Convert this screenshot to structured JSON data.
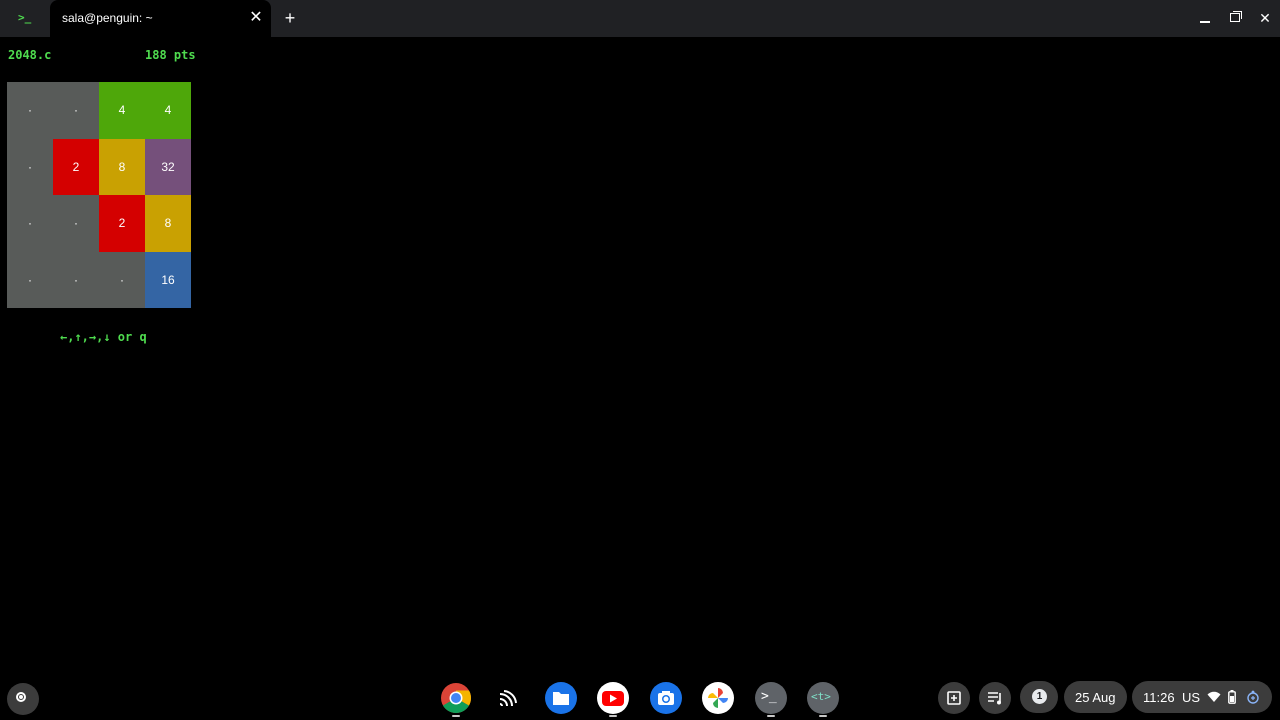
{
  "window": {
    "app_icon": ">_",
    "tab_title": "sala@penguin: ~",
    "tab_close": "✕",
    "new_tab": "+",
    "close": "✕"
  },
  "game": {
    "name": "2048.c",
    "score": "188 pts",
    "controls": "←,↑,→,↓ or q",
    "board": [
      [
        "·",
        "·",
        "4",
        "4"
      ],
      [
        "·",
        "2",
        "8",
        "32"
      ],
      [
        "·",
        "·",
        "2",
        "8"
      ],
      [
        "·",
        "·",
        "·",
        "16"
      ]
    ],
    "colors": {
      "empty": "#585b59",
      "2": "#d40000",
      "4": "#4ea70a",
      "8": "#c9a102",
      "16": "#3465a4",
      "32": "#75507b"
    }
  },
  "shelf": {
    "apps": [
      {
        "name": "chrome-icon",
        "running": true
      },
      {
        "name": "cast-icon",
        "running": false
      },
      {
        "name": "files-icon",
        "running": false
      },
      {
        "name": "youtube-icon",
        "running": true
      },
      {
        "name": "camera-icon",
        "running": false
      },
      {
        "name": "photos-icon",
        "running": false
      },
      {
        "name": "terminal-icon",
        "running": true
      },
      {
        "name": "text-editor-icon",
        "running": true
      }
    ],
    "terminal_glyph": ">_",
    "text_editor_glyph": "<t>",
    "notification_count": "1",
    "date": "25 Aug",
    "time": "11:26",
    "locale": "US"
  }
}
